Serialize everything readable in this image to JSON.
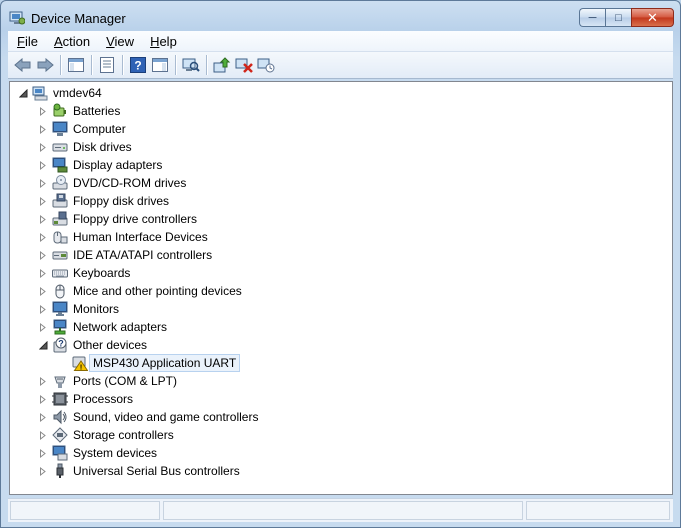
{
  "window": {
    "title": "Device Manager"
  },
  "menu": [
    {
      "access": "F",
      "rest": "ile"
    },
    {
      "access": "A",
      "rest": "ction"
    },
    {
      "access": "V",
      "rest": "iew"
    },
    {
      "access": "H",
      "rest": "elp"
    }
  ],
  "toolbar": [
    "back-icon",
    "forward-icon",
    "separator",
    "show-hide-console-tree-icon",
    "separator",
    "properties-icon",
    "separator",
    "help-icon",
    "show-action-pane-icon",
    "separator",
    "scan-hardware-icon",
    "separator",
    "update-driver-icon",
    "uninstall-icon",
    "disable-icon"
  ],
  "tree": {
    "root": "vmdev64",
    "categories": [
      {
        "label": "Batteries",
        "icon": "battery-icon"
      },
      {
        "label": "Computer",
        "icon": "computer-icon"
      },
      {
        "label": "Disk drives",
        "icon": "disk-drive-icon"
      },
      {
        "label": "Display adapters",
        "icon": "display-adapter-icon"
      },
      {
        "label": "DVD/CD-ROM drives",
        "icon": "dvd-drive-icon"
      },
      {
        "label": "Floppy disk drives",
        "icon": "floppy-disk-icon"
      },
      {
        "label": "Floppy drive controllers",
        "icon": "floppy-controller-icon"
      },
      {
        "label": "Human Interface Devices",
        "icon": "hid-icon"
      },
      {
        "label": "IDE ATA/ATAPI controllers",
        "icon": "ide-controller-icon"
      },
      {
        "label": "Keyboards",
        "icon": "keyboard-icon"
      },
      {
        "label": "Mice and other pointing devices",
        "icon": "mouse-icon"
      },
      {
        "label": "Monitors",
        "icon": "monitor-icon"
      },
      {
        "label": "Network adapters",
        "icon": "network-adapter-icon"
      },
      {
        "label": "Other devices",
        "icon": "unknown-device-icon",
        "expanded": true,
        "children": [
          {
            "label": "MSP430 Application UART",
            "icon": "warning-device-icon",
            "selected": true
          }
        ]
      },
      {
        "label": "Ports (COM & LPT)",
        "icon": "port-icon"
      },
      {
        "label": "Processors",
        "icon": "processor-icon"
      },
      {
        "label": "Sound, video and game controllers",
        "icon": "sound-icon"
      },
      {
        "label": "Storage controllers",
        "icon": "storage-controller-icon"
      },
      {
        "label": "System devices",
        "icon": "system-devices-icon"
      },
      {
        "label": "Universal Serial Bus controllers",
        "icon": "usb-icon"
      }
    ]
  },
  "colors": {
    "selection_bg": "#eaf2fb",
    "selection_border": "#b8d2ef",
    "chrome": "#b9d1ea",
    "warning": "#f5c400"
  }
}
